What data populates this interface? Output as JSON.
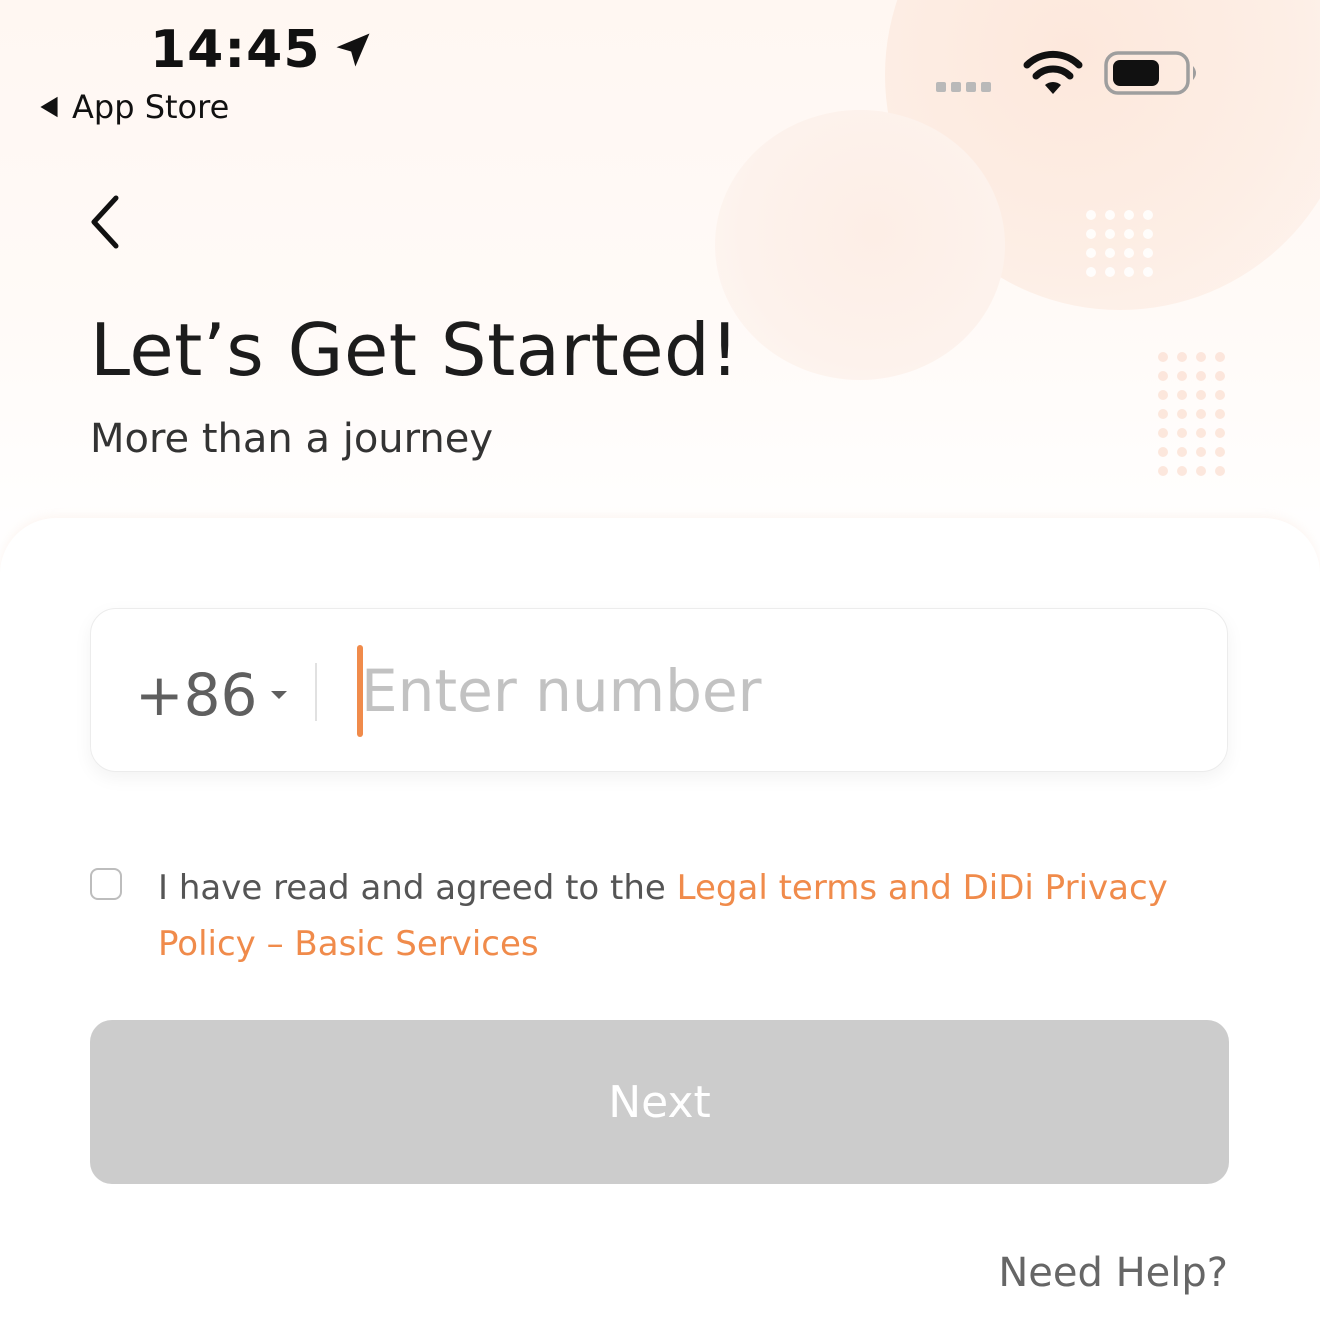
{
  "status_bar": {
    "time": "14:45",
    "back_app_label": "App Store"
  },
  "header": {
    "title": "Let’s Get Started!",
    "subtitle": "More than a journey"
  },
  "phone": {
    "country_code": "+86",
    "placeholder": "Enter number",
    "value": ""
  },
  "agreement": {
    "checked": false,
    "text_prefix": "I have read and agreed to the ",
    "link_text": "Legal terms and DiDi Privacy Policy – Basic Services"
  },
  "actions": {
    "next_label": "Next",
    "help_label": "Need Help?"
  },
  "colors": {
    "accent": "#f08b4b",
    "button_disabled_bg": "#cccccc",
    "button_text": "#ffffff"
  }
}
